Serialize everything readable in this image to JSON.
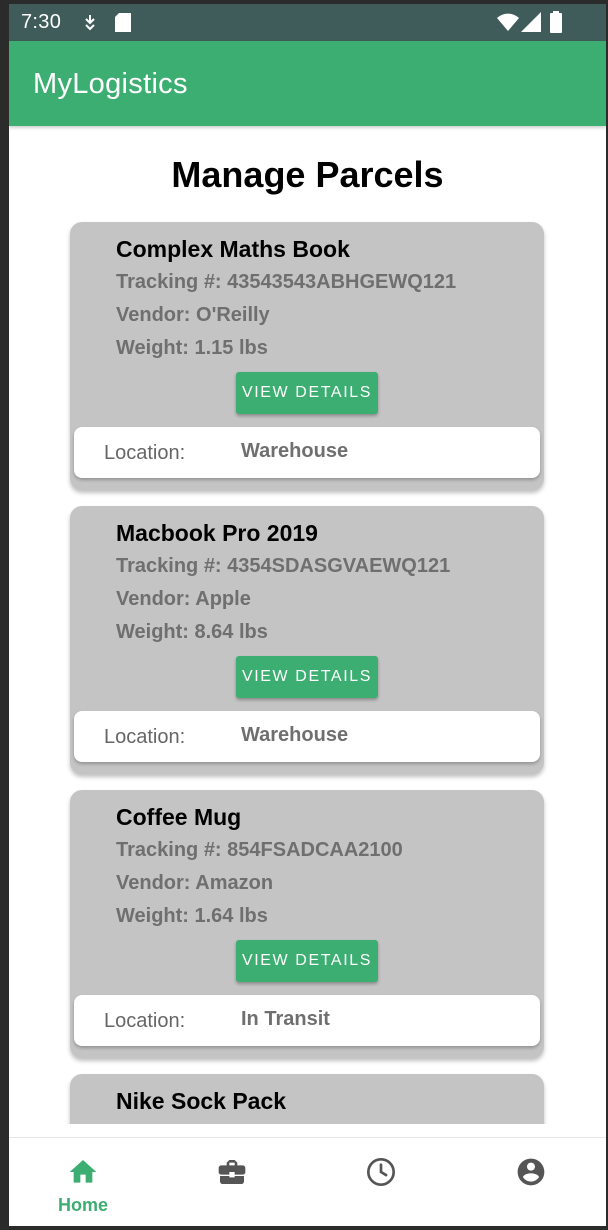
{
  "status_bar": {
    "time": "7:30"
  },
  "app_bar": {
    "title": "MyLogistics"
  },
  "page": {
    "title": "Manage Parcels"
  },
  "parcels": [
    {
      "name": "Complex Maths Book",
      "tracking": "Tracking #: 43543543ABHGEWQ121",
      "vendor": "Vendor: O'Reilly",
      "weight": "Weight: 1.15 lbs",
      "button_label": "VIEW DETAILS",
      "location_label": "Location:",
      "location_value": "Warehouse"
    },
    {
      "name": "Macbook Pro 2019",
      "tracking": "Tracking #: 4354SDASGVAEWQ121",
      "vendor": "Vendor: Apple",
      "weight": "Weight: 8.64 lbs",
      "button_label": "VIEW DETAILS",
      "location_label": "Location:",
      "location_value": "Warehouse"
    },
    {
      "name": "Coffee Mug",
      "tracking": "Tracking #: 854FSADCAA2100",
      "vendor": "Vendor: Amazon",
      "weight": "Weight: 1.64 lbs",
      "button_label": "VIEW DETAILS",
      "location_label": "Location:",
      "location_value": "In Transit"
    },
    {
      "name": "Nike Sock Pack"
    }
  ],
  "bottom_nav": {
    "items": [
      {
        "label": "Home",
        "icon": "home-icon",
        "active": true
      },
      {
        "label": "",
        "icon": "briefcase-icon",
        "active": false
      },
      {
        "label": "",
        "icon": "clock-icon",
        "active": false
      },
      {
        "label": "",
        "icon": "account-icon",
        "active": false
      }
    ]
  },
  "colors": {
    "accent": "#3dae72",
    "status_bar": "#3f5c5a",
    "card_bg": "#c4c4c4",
    "inactive_icon": "#555555"
  }
}
